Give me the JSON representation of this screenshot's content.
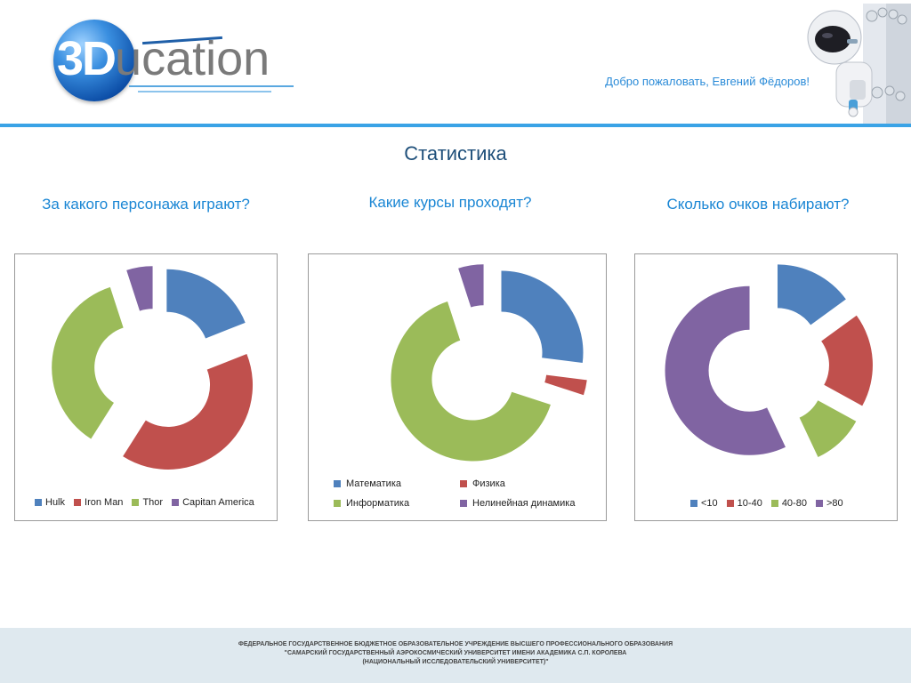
{
  "header": {
    "logo_prefix": "3D",
    "logo_rest": "ucation",
    "welcome": "Добро пожаловать, Евгений Фёдоров!"
  },
  "page": {
    "title": "Статистика"
  },
  "colors": {
    "blue": "#4f81bd",
    "red": "#c0504d",
    "green": "#9bbb59",
    "purple": "#8064a2",
    "accent": "#3aa3e6"
  },
  "chart_data": [
    {
      "type": "pie",
      "title": "За какого персонажа играют?",
      "categories": [
        "Hulk",
        "Iron Man",
        "Thor",
        "Capitan America"
      ],
      "values": [
        19,
        40,
        36,
        5
      ]
    },
    {
      "type": "pie",
      "title": "Какие курсы проходят?",
      "categories": [
        "Математика",
        "Физика",
        "Информатика",
        "Нелинейная динамика"
      ],
      "values": [
        27,
        3,
        65,
        5
      ]
    },
    {
      "type": "pie",
      "title": "Сколько очков набирают?",
      "categories": [
        "<10",
        "10-40",
        "40-80",
        ">80"
      ],
      "values": [
        15,
        18,
        10,
        57
      ]
    }
  ],
  "footer": {
    "line1": "ФЕДЕРАЛЬНОЕ ГОСУДАРСТВЕННОЕ БЮДЖЕТНОЕ ОБРАЗОВАТЕЛЬНОЕ УЧРЕЖДЕНИЕ ВЫСШЕГО ПРОФЕССИОНАЛЬНОГО ОБРАЗОВАНИЯ",
    "line2": "\"САМАРСКИЙ ГОСУДАРСТВЕННЫЙ АЭРОКОСМИЧЕСКИЙ УНИВЕРСИТЕТ ИМЕНИ АКАДЕМИКА С.П. КОРОЛЕВА",
    "line3": "(НАЦИОНАЛЬНЫЙ ИССЛЕДОВАТЕЛЬСКИЙ УНИВЕРСИТЕТ)\""
  }
}
